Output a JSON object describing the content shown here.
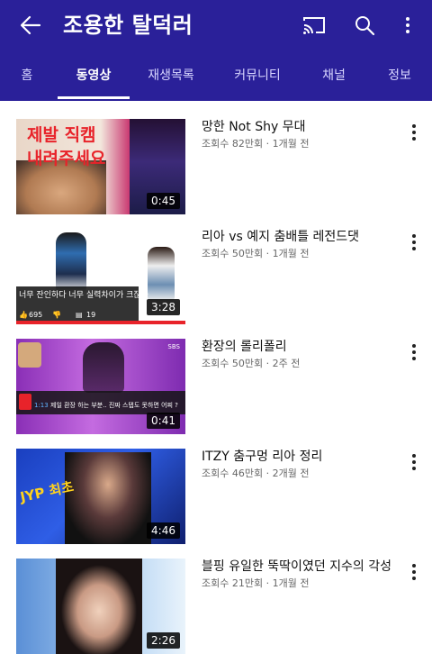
{
  "header": {
    "title": "조용한 탈덕러",
    "icons": {
      "back": "arrow-left-icon",
      "cast": "cast-icon",
      "search": "search-icon",
      "more": "more-vertical-icon"
    }
  },
  "tabs": [
    {
      "label": "홈",
      "active": false
    },
    {
      "label": "동영상",
      "active": true
    },
    {
      "label": "재생목록",
      "active": false
    },
    {
      "label": "커뮤니티",
      "active": false
    },
    {
      "label": "채널",
      "active": false
    },
    {
      "label": "정보",
      "active": false
    }
  ],
  "videos": [
    {
      "title": "망한 Not Shy 무대",
      "meta": "조회수 82만회 · 1개월 전",
      "duration": "0:45",
      "overlay_text": [
        "제발 직캠",
        "내려주세요"
      ]
    },
    {
      "title": "리아 vs 예지 춤배틀 레전드댓",
      "meta": "조회수 50만회 · 1개월 전",
      "duration": "3:28",
      "comment": "너무 잔인하다 너무 실력차이가 크잖아",
      "likes": "695",
      "replies": "19"
    },
    {
      "title": "환장의 롤리폴리",
      "meta": "조회수 50만회 · 2주 전",
      "duration": "0:41",
      "broadcaster": "SBS",
      "comment_time": "1:13",
      "comment": "제일 환장 하는 부분.. 진짜 스탭도 못하면 어찌 ?"
    },
    {
      "title": "ITZY 춤구멍 리아 정리",
      "meta": "조회수 46만회 · 2개월 전",
      "duration": "4:46",
      "overlay_text": [
        "JYP 최초"
      ]
    },
    {
      "title": "블핑 유일한 뚝딱이였던 지수의 각성",
      "meta": "조회수 21만회 · 1개월 전",
      "duration": "2:26"
    }
  ],
  "colors": {
    "appbar": "#2a2099",
    "tab_inactive": "#d8d6ff",
    "tab_active": "#ffffff",
    "accent_red": "#e8232a"
  }
}
